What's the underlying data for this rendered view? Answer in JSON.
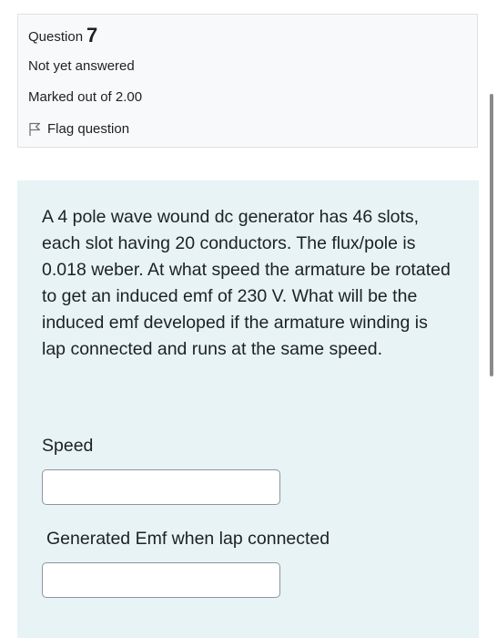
{
  "question_info": {
    "label": "Question",
    "number": "7",
    "state": "Not yet answered",
    "grade": "Marked out of 2.00",
    "flag_label": "Flag question",
    "flag_icon": "flag-icon"
  },
  "question": {
    "text": "A 4 pole wave wound dc generator has 46 slots, each slot having 20 conductors. The flux/pole is 0.018 weber. At what speed the armature be rotated to get an induced emf of 230 V. What will be the induced emf developed if the armature winding is lap connected and runs at the same speed.",
    "fields": [
      {
        "label": "Speed",
        "value": ""
      },
      {
        "label": "Generated Emf when lap connected",
        "value": ""
      }
    ]
  },
  "colors": {
    "info_background": "#f8f9fa",
    "content_background": "#e7f3f5",
    "text": "#1d2125"
  }
}
